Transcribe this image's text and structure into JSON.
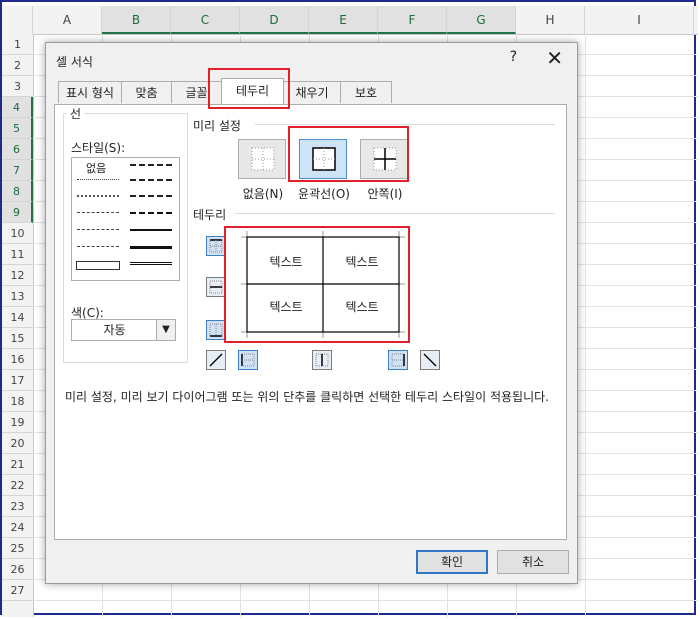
{
  "spreadsheet": {
    "corner": "",
    "columns": [
      "A",
      "B",
      "C",
      "D",
      "E",
      "F",
      "G",
      "H",
      "I"
    ],
    "rows": [
      "1",
      "2",
      "3",
      "4",
      "5",
      "6",
      "7",
      "8",
      "9",
      "10",
      "11",
      "12",
      "13",
      "14",
      "15",
      "16",
      "17",
      "18",
      "19",
      "20",
      "21",
      "22",
      "23",
      "24",
      "25",
      "26",
      "27"
    ]
  },
  "dialog": {
    "title": "셀 서식",
    "help": "?",
    "close": "✕",
    "tabs": [
      "표시 형식",
      "맞춤",
      "글꼴",
      "테두리",
      "채우기",
      "보호"
    ],
    "line_group": {
      "title": "선",
      "style_label": "스타일(S):",
      "none_label": "없음",
      "color_label": "색(C):",
      "color_value": "자동"
    },
    "presets": {
      "title": "미리 설정",
      "items": [
        "없음(N)",
        "윤곽선(O)",
        "안쪽(I)"
      ]
    },
    "border": {
      "title": "테두리",
      "preview_text": [
        "텍스트",
        "텍스트",
        "텍스트",
        "텍스트"
      ]
    },
    "hint": "미리 설정, 미리 보기 다이어그램 또는 위의 단추를 클릭하면 선택한 테두리 스타일이 적용됩니다.",
    "ok_label": "확인",
    "cancel_label": "취소"
  },
  "colors": {
    "highlight": "#e0202b",
    "accent": "#217346",
    "selected_button": "#cfe3f7"
  }
}
